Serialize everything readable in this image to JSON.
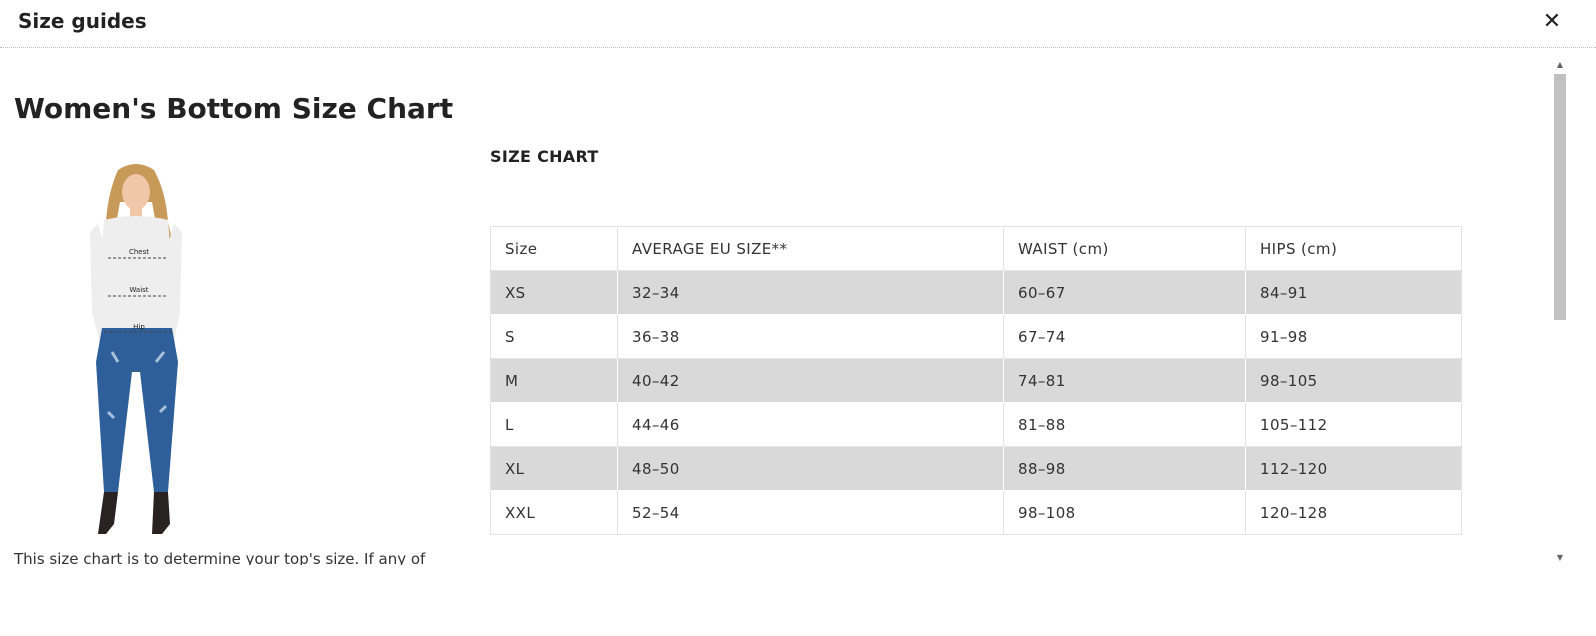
{
  "header": {
    "title": "Size guides",
    "close_icon": "close-icon"
  },
  "content": {
    "page_title": "Women's Bottom Size Chart",
    "section_label": "SIZE CHART",
    "figure_labels": {
      "chest": "Chest",
      "waist": "Waist",
      "hip": "Hip"
    },
    "description": "This size chart is to determine your top's size. If any of"
  },
  "table": {
    "headers": [
      "Size",
      "AVERAGE EU SIZE**",
      "WAIST (cm)",
      "HIPS (cm)"
    ],
    "rows": [
      [
        "XS",
        "32–34",
        "60–67",
        "84–91"
      ],
      [
        "S",
        "36–38",
        "67–74",
        "91–98"
      ],
      [
        "M",
        "40–42",
        "74–81",
        "98–105"
      ],
      [
        "L",
        "44–46",
        "81–88",
        "105–112"
      ],
      [
        "XL",
        "48–50",
        "88–98",
        "112–120"
      ],
      [
        "XXL",
        "52–54",
        "98–108",
        "120–128"
      ]
    ]
  },
  "colors": {
    "shaded_row": "#d9d9d9",
    "text": "#222222",
    "denim": "#2f5f9a"
  }
}
